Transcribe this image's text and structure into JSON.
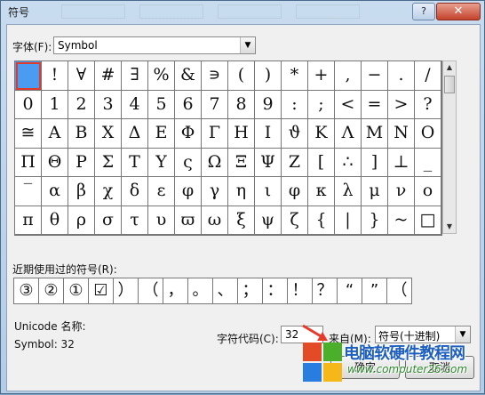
{
  "window": {
    "title": "符号",
    "help_label": "?",
    "close_label": "✕"
  },
  "font": {
    "label": "字体(F):",
    "value": "Symbol"
  },
  "grid": [
    " ",
    "!",
    "∀",
    "#",
    "∃",
    "%",
    "&",
    "∍",
    "(",
    ")",
    "*",
    "+",
    ",",
    "−",
    ".",
    "/",
    "0",
    "1",
    "2",
    "3",
    "4",
    "5",
    "6",
    "7",
    "8",
    "9",
    ":",
    ";",
    "<",
    "=",
    ">",
    "?",
    "≅",
    "Α",
    "Β",
    "Χ",
    "Δ",
    "Ε",
    "Φ",
    "Γ",
    "Η",
    "Ι",
    "ϑ",
    "Κ",
    "Λ",
    "Μ",
    "Ν",
    "Ο",
    "Π",
    "Θ",
    "Ρ",
    "Σ",
    "Τ",
    "Υ",
    "ς",
    "Ω",
    "Ξ",
    "Ψ",
    "Ζ",
    "[",
    "∴",
    "]",
    "⊥",
    "_",
    "‾",
    "α",
    "β",
    "χ",
    "δ",
    "ε",
    "φ",
    "γ",
    "η",
    "ι",
    "φ",
    "κ",
    "λ",
    "μ",
    "ν",
    "ο",
    "π",
    "θ",
    "ρ",
    "σ",
    "τ",
    "υ",
    "ϖ",
    "ω",
    "ξ",
    "ψ",
    "ζ",
    "{",
    "|",
    "}",
    "~",
    "□"
  ],
  "recent": {
    "label": "近期使用过的符号(R):",
    "items": [
      "③",
      "②",
      "①",
      "☑",
      "）",
      "（",
      "，",
      "。",
      "、",
      "；",
      "：",
      "！",
      "？",
      "“",
      "”",
      "（"
    ]
  },
  "info": {
    "unicode_name_label": "Unicode 名称:",
    "symbol_code": "Symbol: 32"
  },
  "char_code": {
    "label": "字符代码(C):",
    "value": "32"
  },
  "from": {
    "label": "来自(M):",
    "value": "符号(十进制)"
  },
  "buttons": {
    "ok": "确定",
    "cancel": "取消"
  },
  "watermark": {
    "title": "电脑软硬件教程网",
    "url": "www.computer26.com"
  }
}
